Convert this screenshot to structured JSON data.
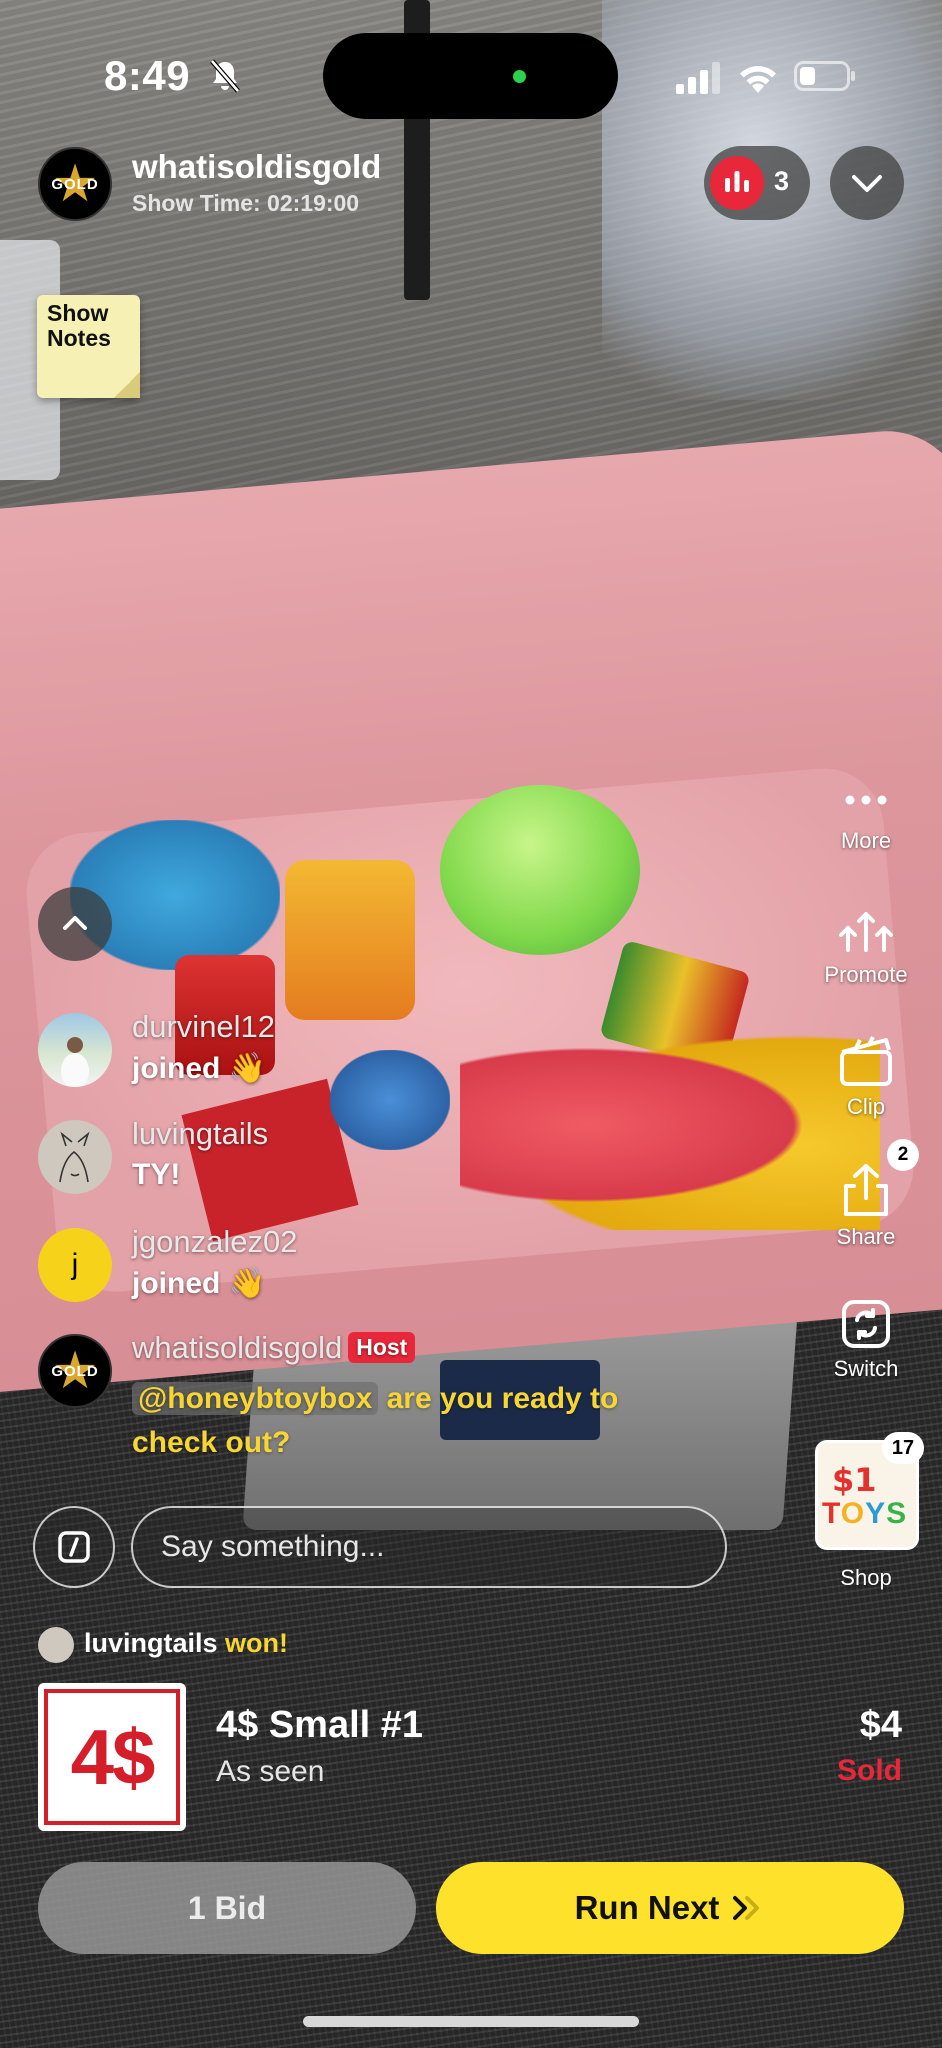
{
  "status_bar": {
    "time": "8:49"
  },
  "header": {
    "avatar_text": "GOLD",
    "host_name": "whatisoldisgold",
    "show_time": "Show Time: 02:19:00",
    "viewer_count": "3"
  },
  "show_notes": {
    "label_line1": "Show",
    "label_line2": "Notes"
  },
  "right_rail": {
    "more_label": "More",
    "promote_label": "Promote",
    "clip_label": "Clip",
    "share_label": "Share",
    "share_badge": "2",
    "switch_label": "Switch",
    "shop_label": "Shop",
    "shop_badge": "17",
    "shop_thumb_line1": "$1",
    "shop_thumb_line2": [
      "T",
      "O",
      "Y",
      "S"
    ]
  },
  "chat": {
    "messages": [
      {
        "user": "durvinel12",
        "text": "joined 👋"
      },
      {
        "user": "luvingtails",
        "text": "TY!"
      },
      {
        "user": "jgonzalez02",
        "text": "joined 👋",
        "avatar_letter": "j"
      }
    ],
    "host_message": {
      "user": "whatisoldisgold",
      "tag": "Host",
      "mention": "@honeybtoybox",
      "text": " are you ready to check out?"
    },
    "input_placeholder": "Say something..."
  },
  "auction": {
    "winner": "luvingtails",
    "won_text": "won!",
    "thumb_text": "4$",
    "title": "4$ Small #1",
    "subtitle": "As seen",
    "price": "$4",
    "status": "Sold",
    "bid_label": "1 Bid",
    "run_next_label": "Run Next"
  },
  "colors": {
    "accent_yellow": "#fde12b",
    "live_red": "#e8283a",
    "host_tag_red": "#e8283a",
    "mention_yellow": "#f7d633"
  }
}
